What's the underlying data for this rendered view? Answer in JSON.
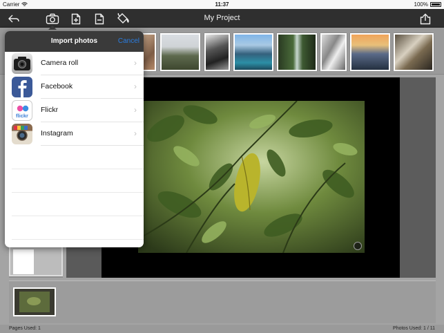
{
  "status": {
    "carrier": "Carrier",
    "time": "11:37",
    "battery": "100%"
  },
  "nav": {
    "title": "My Project",
    "icons": [
      "back-arrow-icon",
      "camera-icon",
      "add-page-icon",
      "remove-page-icon",
      "paint-bucket-icon",
      "share-icon"
    ]
  },
  "popover": {
    "title": "Import photos",
    "cancel": "Cancel",
    "items": [
      {
        "label": "Camera roll",
        "icon": "camera-roll-icon"
      },
      {
        "label": "Facebook",
        "icon": "facebook-icon"
      },
      {
        "label": "Flickr",
        "icon": "flickr-icon",
        "icon_text": "flickr"
      },
      {
        "label": "Instagram",
        "icon": "instagram-icon"
      }
    ]
  },
  "footer": {
    "pages_used": "Pages Used: 1",
    "photos_used": "Photos Used: 1 / 11"
  },
  "colors": {
    "navbar": "#2f2f2f",
    "accent": "#2a7de1",
    "facebook": "#3b5998"
  }
}
